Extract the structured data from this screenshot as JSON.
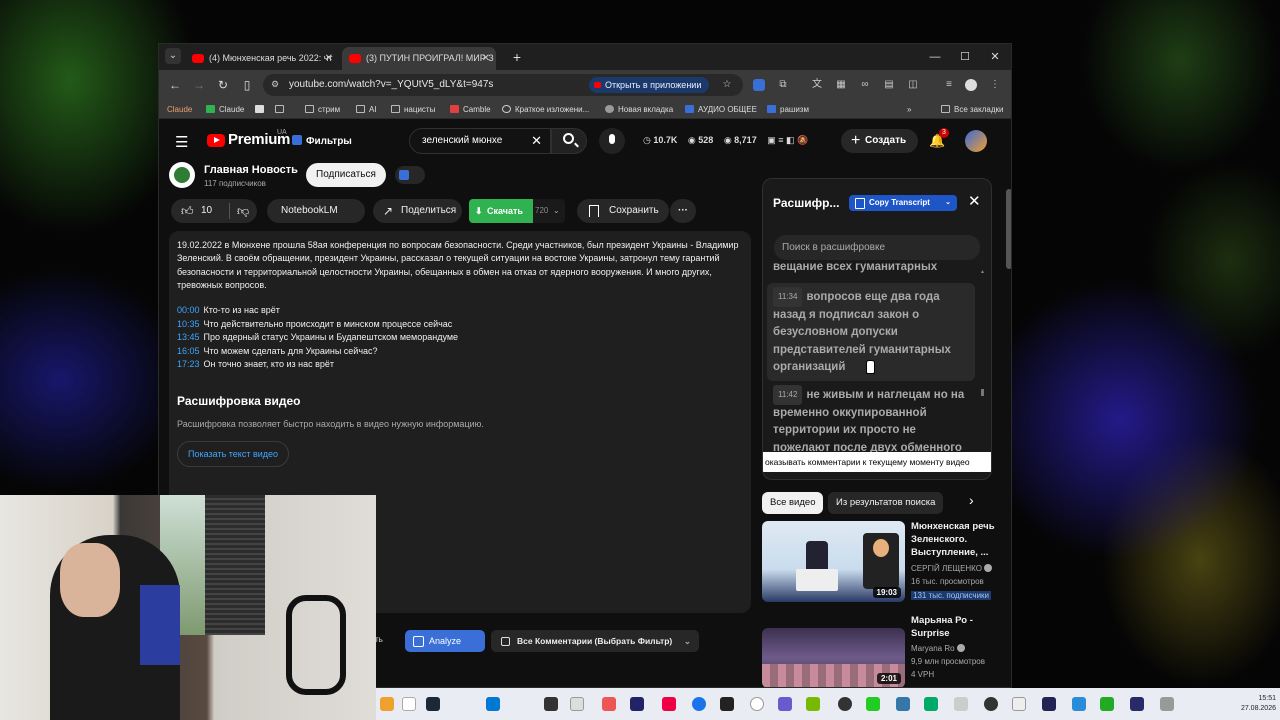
{
  "browser": {
    "tabs": [
      {
        "label": "(4) Мюнхенская речь 2022: чт"
      },
      {
        "label": "(3) ПУТИН ПРОИГРАЛ! МИР З"
      }
    ],
    "url": "youtube.com/watch?v=_YQUtV5_dLY&t=947s",
    "open_in_app": "Открыть в приложении",
    "bookmarks": [
      "Claude",
      "Claude",
      "стрим",
      "AI",
      "нацисты",
      "Camble",
      "Краткое изложени...",
      "Новая вкладка",
      "АУДИО ОБЩЕЕ",
      "рашизм"
    ],
    "all_bookmarks": "Все закладки"
  },
  "header": {
    "brand": "Premium",
    "region": "UA",
    "filters": "Фильтры",
    "search_query": "зеленский мюнхе",
    "stats": {
      "views": "10.7K",
      "watching": "528",
      "other": "8,717"
    },
    "create": "Создать",
    "notif_count": "3"
  },
  "channel": {
    "name": "Главная Новость",
    "subs": "117 подписчиков",
    "subscribe": "Подписаться"
  },
  "actions": {
    "likes": "10",
    "notebook": "NotebookLM",
    "share": "Поделиться",
    "download": "Скачать",
    "quality": "720",
    "save": "Сохранить",
    "more": "···"
  },
  "description": {
    "text": "19.02.2022 в Мюнхене прошла 58ая конференция по вопросам безопасности. Среди участников, был президент Украины - Владимир Зеленский. В своём обращении, президент Украины, рассказал о текущей ситуации на востоке Украины, затронул тему гарантий безопасности и территориальной целостности Украины, обещанных в обмен на отказ от ядерного вооружения. И много других, тревожных вопросов.",
    "chapters": [
      {
        "time": "00:00",
        "title": "Кто-то из нас врёт"
      },
      {
        "time": "10:35",
        "title": "Что действительно происходит в минском процессе сейчас"
      },
      {
        "time": "13:45",
        "title": "Про ядерный статус Украины и Будапештском меморандуме"
      },
      {
        "time": "16:05",
        "title": "Что можем сделать для Украины сейчас?"
      },
      {
        "time": "17:23",
        "title": "Он точно знает, кто из нас врёт"
      }
    ],
    "transcript_heading": "Расшифровка видео",
    "transcript_sub": "Расшифровка позволяет быстро находить в видео нужную информацию.",
    "show_transcript": "Показать текст видео"
  },
  "bottom_bar": {
    "behind_text": "ть",
    "analyze": "Analyze",
    "comments_filter": "Все Комментарии (Выбрать Фильтр)"
  },
  "transcript": {
    "title": "Расшифр...",
    "copy": "Copy Transcript",
    "search_placeholder": "Поиск в расшифровке",
    "segments": [
      {
        "time": "",
        "text": "вещание всех гуманитарных"
      },
      {
        "time": "11:34",
        "text": "вопросов еще два года назад я подписал закон о безусловном допуски представителей гуманитарных организаций"
      },
      {
        "time": "11:42",
        "text": "не живым и наглецам но на временно оккупированной территории их просто не пожелают после двух обменного"
      }
    ],
    "banner": "оказывать комментарии к текущему моменту видео"
  },
  "chips": {
    "all": "Все видео",
    "from_search": "Из результатов поиска"
  },
  "recommended": [
    {
      "title": "Мюнхенская речь Зеленского. Выступление, ...",
      "channel": "СЕРГІЙ ЛЕЩЕНКО",
      "views": "16 тыс. просмотров",
      "subs": "131 тыс. подписчики",
      "duration": "19:03"
    },
    {
      "title": "Марьяна Ро - Surprise",
      "channel": "Maryana Ro",
      "views": "9,9 млн просмотров",
      "badge": "4 VPH",
      "duration": "2:01"
    }
  ],
  "taskbar": {
    "time": "15:51",
    "date": "27.08.2026"
  }
}
